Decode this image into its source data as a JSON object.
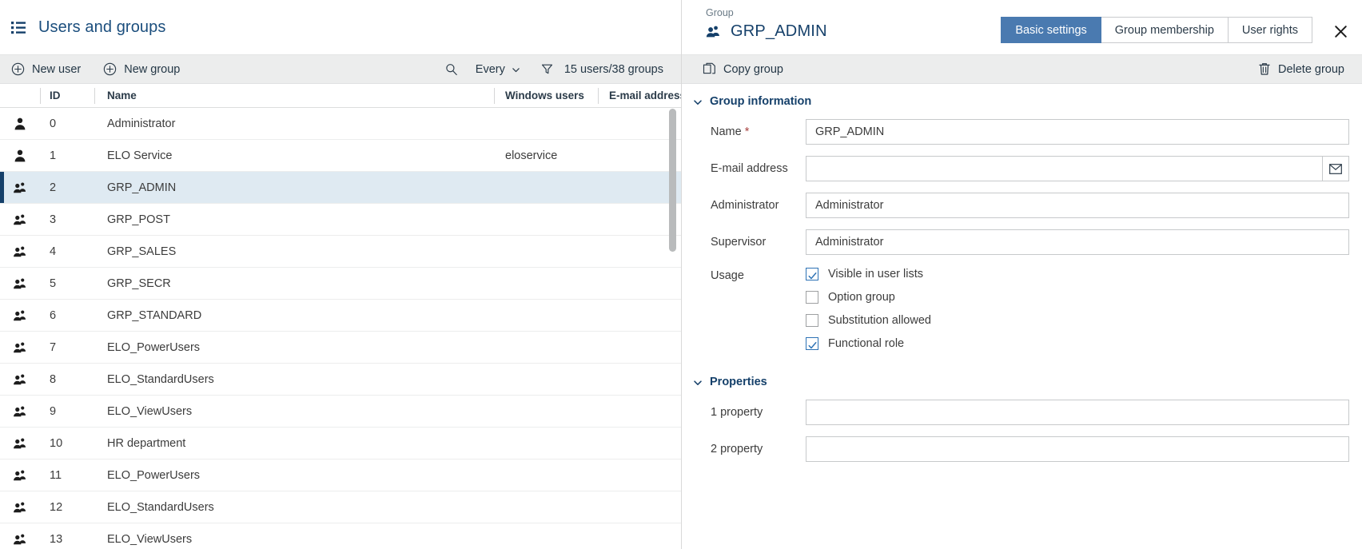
{
  "left": {
    "header": {
      "title": "Users and groups",
      "icon": "list-icon"
    },
    "toolbar": {
      "new_user": "New user",
      "new_group": "New group",
      "filter_select": "Every",
      "count": "15 users/38 groups"
    },
    "columns": [
      "",
      "ID",
      "Name",
      "Windows users",
      "E-mail address"
    ],
    "rows": [
      {
        "icon": "user",
        "id": "0",
        "name": "Administrator",
        "windows": "",
        "email": "",
        "selected": false
      },
      {
        "icon": "user",
        "id": "1",
        "name": "ELO Service",
        "windows": "eloservice",
        "email": "",
        "selected": false
      },
      {
        "icon": "group",
        "id": "2",
        "name": "GRP_ADMIN",
        "windows": "",
        "email": "",
        "selected": true
      },
      {
        "icon": "group",
        "id": "3",
        "name": "GRP_POST",
        "windows": "",
        "email": "",
        "selected": false
      },
      {
        "icon": "group",
        "id": "4",
        "name": "GRP_SALES",
        "windows": "",
        "email": "",
        "selected": false
      },
      {
        "icon": "group",
        "id": "5",
        "name": "GRP_SECR",
        "windows": "",
        "email": "",
        "selected": false
      },
      {
        "icon": "group",
        "id": "6",
        "name": "GRP_STANDARD",
        "windows": "",
        "email": "",
        "selected": false
      },
      {
        "icon": "group",
        "id": "7",
        "name": "ELO_PowerUsers",
        "windows": "",
        "email": "",
        "selected": false
      },
      {
        "icon": "group",
        "id": "8",
        "name": "ELO_StandardUsers",
        "windows": "",
        "email": "",
        "selected": false
      },
      {
        "icon": "group",
        "id": "9",
        "name": "ELO_ViewUsers",
        "windows": "",
        "email": "",
        "selected": false
      },
      {
        "icon": "group",
        "id": "10",
        "name": "HR department",
        "windows": "",
        "email": "",
        "selected": false
      },
      {
        "icon": "group",
        "id": "11",
        "name": "ELO_PowerUsers",
        "windows": "",
        "email": "",
        "selected": false
      },
      {
        "icon": "group",
        "id": "12",
        "name": "ELO_StandardUsers",
        "windows": "",
        "email": "",
        "selected": false
      },
      {
        "icon": "group",
        "id": "13",
        "name": "ELO_ViewUsers",
        "windows": "",
        "email": "",
        "selected": false
      }
    ]
  },
  "right": {
    "kicker": "Group",
    "title": "GRP_ADMIN",
    "tabs": [
      {
        "label": "Basic settings",
        "active": true
      },
      {
        "label": "Group membership",
        "active": false
      },
      {
        "label": "User rights",
        "active": false
      }
    ],
    "toolbar": {
      "copy_group": "Copy group",
      "delete_group": "Delete group"
    },
    "sections": {
      "group_information": {
        "title": "Group information",
        "fields": [
          {
            "label": "Name",
            "required": true,
            "value": "GRP_ADMIN",
            "placeholder": ""
          },
          {
            "label": "E-mail address",
            "required": false,
            "value": "",
            "placeholder": ""
          },
          {
            "label": "Administrator",
            "required": false,
            "value": "Administrator",
            "placeholder": ""
          },
          {
            "label": "Supervisor",
            "required": false,
            "value": "Administrator",
            "placeholder": ""
          }
        ],
        "usage": {
          "label": "Usage",
          "options": [
            {
              "label": "Visible in user lists",
              "checked": true
            },
            {
              "label": "Option group",
              "checked": false
            },
            {
              "label": "Substitution allowed",
              "checked": false
            },
            {
              "label": "Functional role",
              "checked": true
            }
          ]
        }
      },
      "properties": {
        "title": "Properties",
        "fields": [
          {
            "label": "1 property",
            "value": "",
            "placeholder": ""
          },
          {
            "label": "2 property",
            "value": "",
            "placeholder": ""
          }
        ]
      }
    }
  },
  "colors": {
    "accent_blue": "#15406a",
    "tab_active": "#4a7ab0",
    "selection_row": "#dfeaf2",
    "toolbar_bg": "#eceded",
    "checkbox_blue": "#2d72b5"
  }
}
